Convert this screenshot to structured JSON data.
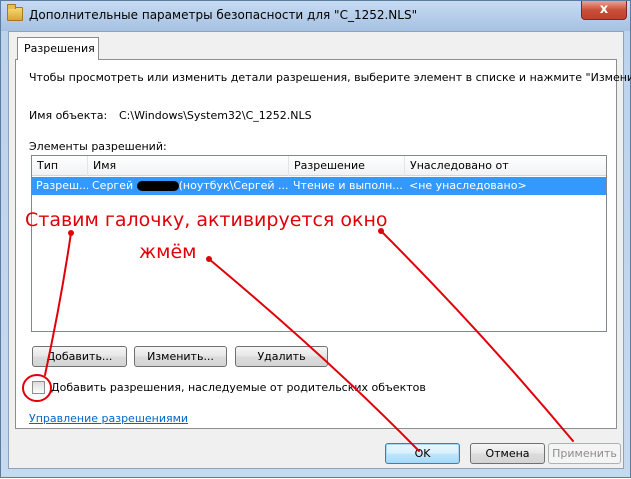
{
  "window": {
    "title": "Дополнительные параметры безопасности  для \"C_1252.NLS\"",
    "close_glyph": "x"
  },
  "tabs": [
    {
      "label": "Разрешения"
    }
  ],
  "panel": {
    "instruction": "Чтобы просмотреть или изменить детали разрешения, выберите элемент в списке и нажмите \"Изменить\".",
    "object_name_label": "Имя объекта:",
    "object_name_value": "C:\\Windows\\System32\\C_1252.NLS",
    "entries_label": "Элементы разрешений:"
  },
  "table": {
    "columns": [
      "Тип",
      "Имя",
      "Разрешение",
      "Унаследовано от"
    ],
    "rows": [
      {
        "type": "Разреш...",
        "name_prefix": "Сергей ",
        "name_suffix": "(ноутбук\\Сергей ...",
        "permission": "Чтение и выполн...",
        "inherited": "<не унаследовано>",
        "selected": true
      }
    ]
  },
  "buttons": {
    "add": "Добавить...",
    "edit": "Изменить...",
    "remove": "Удалить",
    "ok": "OK",
    "cancel": "Отмена",
    "apply": "Применить"
  },
  "inherit_checkbox": {
    "label": "Добавить разрешения, наследуемые от родительских объектов",
    "checked": false
  },
  "manage_link": "Управление разрешениями",
  "annotations": {
    "line1": "Ставим галочку, активируется окно",
    "line2": "жмём"
  },
  "colors": {
    "selection": "#3399ff",
    "annotation": "#e1000a",
    "link": "#0066cc"
  }
}
